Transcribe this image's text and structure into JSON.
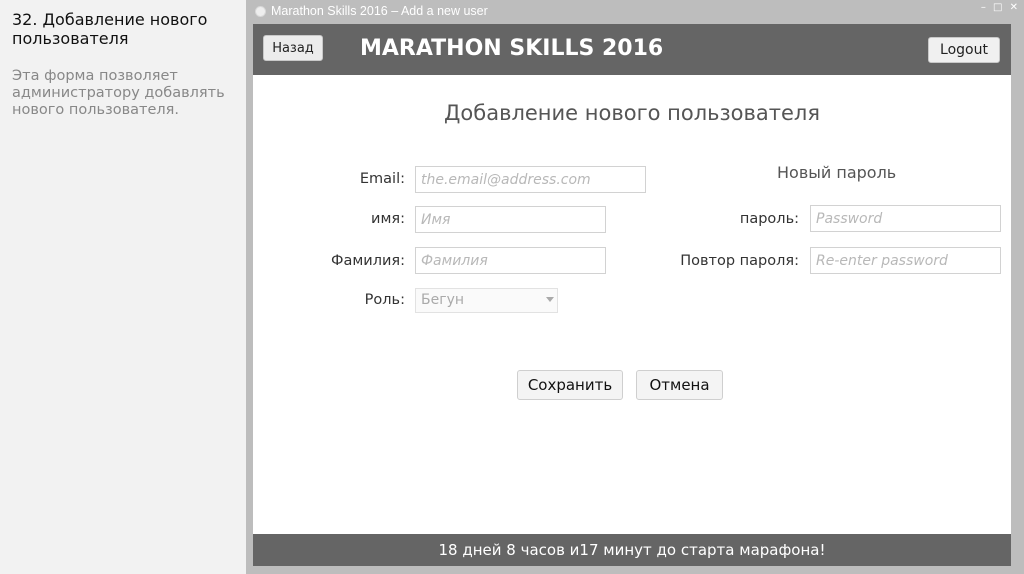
{
  "slide": {
    "title": "32. Добавление нового пользователя",
    "description": "Эта форма позволяет администратору добавлять нового пользователя."
  },
  "window": {
    "title": "Marathon Skills 2016 – Add a new user",
    "controls": "–  □  ✕"
  },
  "header": {
    "back_label": "Назад",
    "app_title": "MARATHON SKILLS 2016",
    "logout_label": "Logout"
  },
  "form": {
    "title": "Добавление нового пользователя",
    "email_label": "Email:",
    "email_placeholder": "the.email@address.com",
    "first_name_label": "имя:",
    "first_name_placeholder": "Имя",
    "last_name_label": "Фамилия:",
    "last_name_placeholder": "Фамилия",
    "role_label": "Роль:",
    "role_value": "Бегун",
    "new_password_heading": "Новый пароль",
    "password_label": "пароль:",
    "password_placeholder": "Password",
    "repeat_password_label": "Повтор пароля:",
    "repeat_password_placeholder": "Re-enter password",
    "save_label": "Сохранить",
    "cancel_label": "Отмена"
  },
  "footer": {
    "countdown": "18 дней 8 часов и17 минут до старта марафона!"
  }
}
